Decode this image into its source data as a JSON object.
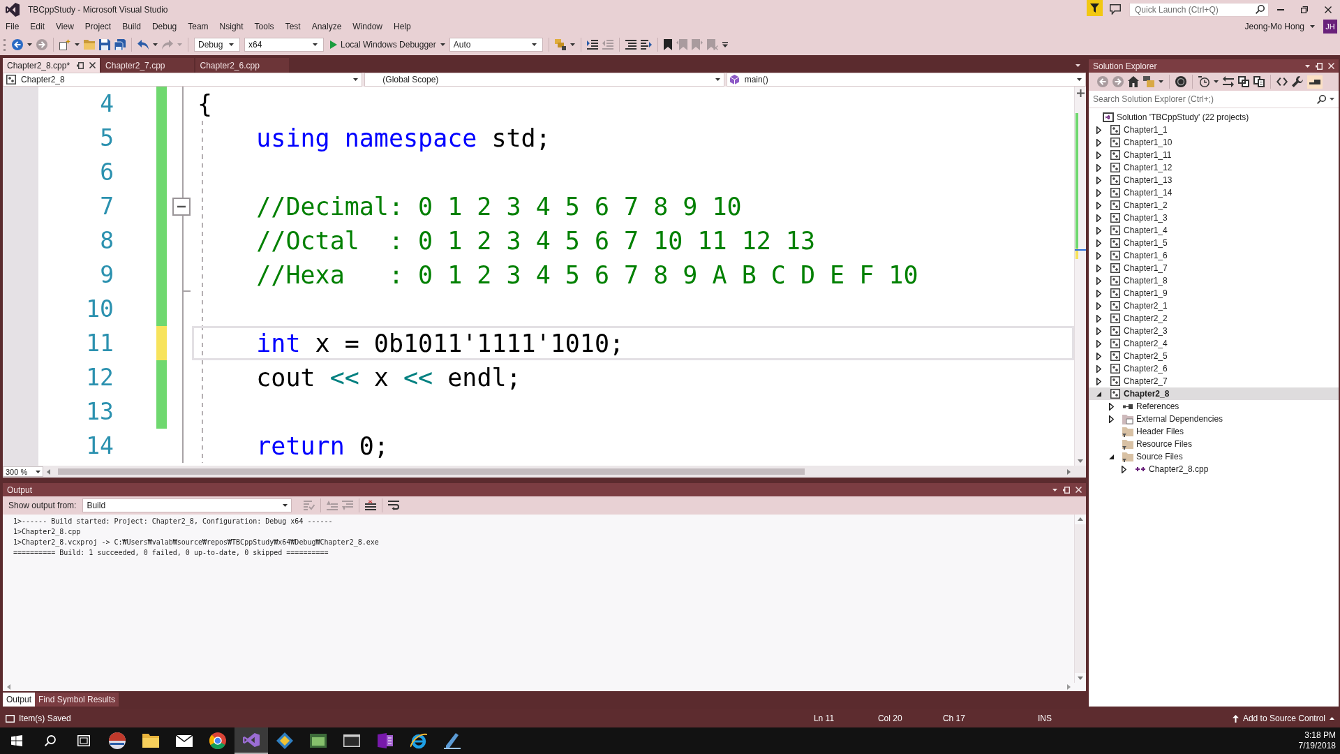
{
  "window": {
    "title": "TBCppStudy - Microsoft Visual Studio",
    "quick_launch": {
      "placeholder": "Quick Launch (Ctrl+Q)"
    },
    "account": {
      "name": "Jeong-Mo Hong",
      "initials": "JH"
    }
  },
  "menu": [
    "File",
    "Edit",
    "View",
    "Project",
    "Build",
    "Debug",
    "Team",
    "Nsight",
    "Tools",
    "Test",
    "Analyze",
    "Window",
    "Help"
  ],
  "toolbar": [
    {
      "kind": "back",
      "disabled": false
    },
    {
      "kind": "dropdown",
      "disabled": false
    },
    {
      "kind": "forward",
      "disabled": true
    },
    {
      "kind": "separator"
    },
    {
      "kind": "new-project",
      "disabled": false
    },
    {
      "kind": "dropdown",
      "disabled": false
    },
    {
      "kind": "open",
      "disabled": false
    },
    {
      "kind": "save",
      "disabled": false
    },
    {
      "kind": "save-all",
      "disabled": false
    },
    {
      "kind": "separator"
    },
    {
      "kind": "undo",
      "disabled": false
    },
    {
      "kind": "dropdown",
      "disabled": false
    },
    {
      "kind": "redo",
      "disabled": true
    },
    {
      "kind": "dropdown",
      "disabled": true
    },
    {
      "kind": "separator"
    },
    {
      "kind": "configuration",
      "value": "Debug"
    },
    {
      "kind": "platform",
      "value": "x64"
    },
    {
      "kind": "run",
      "label": "Local Windows Debugger"
    },
    {
      "kind": "debugger-type",
      "value": "Auto"
    },
    {
      "kind": "separator"
    },
    {
      "kind": "find-files",
      "disabled": false
    },
    {
      "kind": "dropdown",
      "disabled": false
    },
    {
      "kind": "separator"
    },
    {
      "kind": "indent",
      "disabled": false
    },
    {
      "kind": "outdent",
      "disabled": true
    },
    {
      "kind": "separator"
    },
    {
      "kind": "comment",
      "disabled": false
    },
    {
      "kind": "uncomment",
      "disabled": false
    },
    {
      "kind": "separator"
    },
    {
      "kind": "bookmark",
      "disabled": false
    },
    {
      "kind": "bookmark-prev",
      "disabled": true
    },
    {
      "kind": "bookmark-next",
      "disabled": true
    },
    {
      "kind": "bookmark-clear",
      "disabled": true
    },
    {
      "kind": "overflow",
      "disabled": false
    }
  ],
  "editor": {
    "tabs": [
      {
        "label": "Chapter2_8.cpp*",
        "selected": true
      },
      {
        "label": "Chapter2_7.cpp",
        "selected": false
      },
      {
        "label": "Chapter2_6.cpp",
        "selected": false
      }
    ],
    "navigation": [
      {
        "kind": "project",
        "value": "Chapter2_8"
      },
      {
        "kind": "scope",
        "value": "(Global Scope)"
      },
      {
        "kind": "member",
        "value": "main()"
      }
    ],
    "lines": [
      {
        "number": "4",
        "modified": true,
        "saved": true,
        "current": false,
        "tokens": [
          {
            "kind": "plain",
            "text": "{"
          }
        ],
        "children": [
          {
            "number": "5",
            "modified": true,
            "saved": true,
            "current": false,
            "tokens": [
              {
                "kind": "keyword",
                "text": "using namespace"
              },
              {
                "kind": "plain",
                "text": " std;"
              }
            ]
          },
          {
            "number": "6",
            "modified": true,
            "saved": true,
            "current": false
          },
          {
            "number": "7",
            "modified": true,
            "saved": true,
            "current": false,
            "expanded": true,
            "tokens": [
              {
                "kind": "comment",
                "text": "//Decimal: 0 1 2 3 4 5 6 7 8 9 10"
              }
            ]
          },
          {
            "number": "8",
            "modified": true,
            "saved": true,
            "current": false,
            "tokens": [
              {
                "kind": "comment",
                "text": "//Octal  : 0 1 2 3 4 5 6 7 10 11 12 13"
              }
            ]
          },
          {
            "number": "9",
            "modified": true,
            "saved": true,
            "current": false,
            "outline_end": true,
            "tokens": [
              {
                "kind": "comment",
                "text": "//Hexa   : 0 1 2 3 4 5 6 7 8 9 A B C D E F 10"
              }
            ]
          },
          {
            "number": "10",
            "modified": true,
            "saved": true,
            "current": false
          },
          {
            "number": "11",
            "modified": true,
            "saved": false,
            "current": true,
            "tokens": [
              {
                "kind": "keyword",
                "text": "int"
              },
              {
                "kind": "plain",
                "text": " x = 0b1011'1111'1010;"
              }
            ]
          },
          {
            "number": "12",
            "modified": true,
            "saved": true,
            "current": false,
            "tokens": [
              {
                "kind": "plain",
                "text": "cout "
              },
              {
                "kind": "operator",
                "text": "<<"
              },
              {
                "kind": "plain",
                "text": " x "
              },
              {
                "kind": "operator",
                "text": "<<"
              },
              {
                "kind": "plain",
                "text": " endl;"
              }
            ]
          },
          {
            "number": "13",
            "modified": true,
            "saved": true,
            "current": false
          },
          {
            "number": "14",
            "modified": false,
            "current": false,
            "tokens": [
              {
                "kind": "keyword",
                "text": "return"
              },
              {
                "kind": "plain",
                "text": " 0;"
              }
            ]
          }
        ]
      }
    ],
    "zoom": "300 %"
  },
  "solution_explorer": {
    "title": "Solution Explorer",
    "toolbar": [
      {
        "kind": "back",
        "disabled": true
      },
      {
        "kind": "forward",
        "disabled": true
      },
      {
        "kind": "home",
        "disabled": false
      },
      {
        "kind": "switch-views",
        "disabled": false
      },
      {
        "kind": "dropdown",
        "disabled": false
      },
      {
        "kind": "separator"
      },
      {
        "kind": "disc",
        "disabled": false
      },
      {
        "kind": "separator"
      },
      {
        "kind": "pending-changes",
        "disabled": false
      },
      {
        "kind": "dropdown",
        "disabled": false
      },
      {
        "kind": "sync",
        "disabled": false
      },
      {
        "kind": "collapse-all",
        "disabled": false
      },
      {
        "kind": "show-all-files",
        "disabled": false
      },
      {
        "kind": "separator"
      },
      {
        "kind": "code",
        "disabled": false
      },
      {
        "kind": "properties",
        "disabled": false
      },
      {
        "kind": "preview",
        "disabled": false,
        "checked": true
      }
    ],
    "search": {
      "placeholder": "Search Solution Explorer (Ctrl+;)"
    },
    "tree": [
      {
        "label": "Solution 'TBCppStudy' (22 projects)",
        "kind": "solution",
        "selected": false,
        "children": [
          {
            "label": "Chapter1_1",
            "kind": "project",
            "expanded": false,
            "selected": false,
            "startup": false
          },
          {
            "label": "Chapter1_10",
            "kind": "project",
            "expanded": false,
            "selected": false,
            "startup": false
          },
          {
            "label": "Chapter1_11",
            "kind": "project",
            "expanded": false,
            "selected": false,
            "startup": false
          },
          {
            "label": "Chapter1_12",
            "kind": "project",
            "expanded": false,
            "selected": false,
            "startup": false
          },
          {
            "label": "Chapter1_13",
            "kind": "project",
            "expanded": false,
            "selected": false,
            "startup": false
          },
          {
            "label": "Chapter1_14",
            "kind": "project",
            "expanded": false,
            "selected": false,
            "startup": false
          },
          {
            "label": "Chapter1_2",
            "kind": "project",
            "expanded": false,
            "selected": false,
            "startup": false
          },
          {
            "label": "Chapter1_3",
            "kind": "project",
            "expanded": false,
            "selected": false,
            "startup": false
          },
          {
            "label": "Chapter1_4",
            "kind": "project",
            "expanded": false,
            "selected": false,
            "startup": false
          },
          {
            "label": "Chapter1_5",
            "kind": "project",
            "expanded": false,
            "selected": false,
            "startup": false
          },
          {
            "label": "Chapter1_6",
            "kind": "project",
            "expanded": false,
            "selected": false,
            "startup": false
          },
          {
            "label": "Chapter1_7",
            "kind": "project",
            "expanded": false,
            "selected": false,
            "startup": false
          },
          {
            "label": "Chapter1_8",
            "kind": "project",
            "expanded": false,
            "selected": false,
            "startup": false
          },
          {
            "label": "Chapter1_9",
            "kind": "project",
            "expanded": false,
            "selected": false,
            "startup": false
          },
          {
            "label": "Chapter2_1",
            "kind": "project",
            "expanded": false,
            "selected": false,
            "startup": false
          },
          {
            "label": "Chapter2_2",
            "kind": "project",
            "expanded": false,
            "selected": false,
            "startup": false
          },
          {
            "label": "Chapter2_3",
            "kind": "project",
            "expanded": false,
            "selected": false,
            "startup": false
          },
          {
            "label": "Chapter2_4",
            "kind": "project",
            "expanded": false,
            "selected": false,
            "startup": false
          },
          {
            "label": "Chapter2_5",
            "kind": "project",
            "expanded": false,
            "selected": false,
            "startup": false
          },
          {
            "label": "Chapter2_6",
            "kind": "project",
            "expanded": false,
            "selected": false,
            "startup": false
          },
          {
            "label": "Chapter2_7",
            "kind": "project",
            "expanded": false,
            "selected": false,
            "startup": false
          },
          {
            "label": "Chapter2_8",
            "kind": "project",
            "expanded": true,
            "selected": true,
            "startup": true,
            "children": [
              {
                "label": "References",
                "kind": "references",
                "expanded": false,
                "selected": false
              },
              {
                "label": "External Dependencies",
                "kind": "dependencies",
                "expanded": false,
                "selected": false
              },
              {
                "label": "Header Files",
                "kind": "filter",
                "selected": false
              },
              {
                "label": "Resource Files",
                "kind": "filter",
                "selected": false
              },
              {
                "label": "Source Files",
                "kind": "filter",
                "expanded": true,
                "selected": false,
                "children": [
                  {
                    "label": "Chapter2_8.cpp",
                    "kind": "cpp",
                    "expanded": false,
                    "selected": false
                  }
                ]
              }
            ]
          }
        ]
      }
    ]
  },
  "output": {
    "title": "Output",
    "source_label": "Show output from:",
    "source": "Build",
    "toolbar": [
      {
        "kind": "find-message",
        "disabled": true
      },
      {
        "kind": "separator"
      },
      {
        "kind": "prev-message",
        "disabled": true
      },
      {
        "kind": "next-message",
        "disabled": true
      },
      {
        "kind": "separator"
      },
      {
        "kind": "clear-all",
        "disabled": false
      },
      {
        "kind": "separator"
      },
      {
        "kind": "word-wrap",
        "disabled": false
      }
    ],
    "lines": [
      "1>------ Build started: Project: Chapter2_8, Configuration: Debug x64 ------",
      "1>Chapter2_8.cpp",
      "1>Chapter2_8.vcxproj -> C:₩Users₩valab₩source₩repos₩TBCppStudy₩x64₩Debug₩Chapter2_8.exe",
      "========== Build: 1 succeeded, 0 failed, 0 up-to-date, 0 skipped =========="
    ],
    "tabs": [
      {
        "label": "Output",
        "selected": true
      },
      {
        "label": "Find Symbol Results",
        "selected": false
      }
    ]
  },
  "status_bar": {
    "message": "Item(s) Saved",
    "line": "Ln 11",
    "column": "Col 20",
    "character": "Ch 17",
    "mode": "INS",
    "source_control": "Add to Source Control"
  },
  "taskbar": {
    "apps": [
      {
        "kind": "sphere",
        "active": false
      },
      {
        "kind": "folder",
        "active": false
      },
      {
        "kind": "envelope",
        "active": false
      },
      {
        "kind": "browser",
        "active": false
      },
      {
        "kind": "ribbon",
        "active": true
      },
      {
        "kind": "diamond",
        "active": false
      },
      {
        "kind": "framed-window",
        "active": false
      },
      {
        "kind": "dark-window",
        "active": false
      },
      {
        "kind": "notebook",
        "active": false
      },
      {
        "kind": "globe",
        "active": false
      },
      {
        "kind": "pen",
        "active": false
      }
    ],
    "time": "3:18 PM",
    "date": "7/19/2018"
  }
}
